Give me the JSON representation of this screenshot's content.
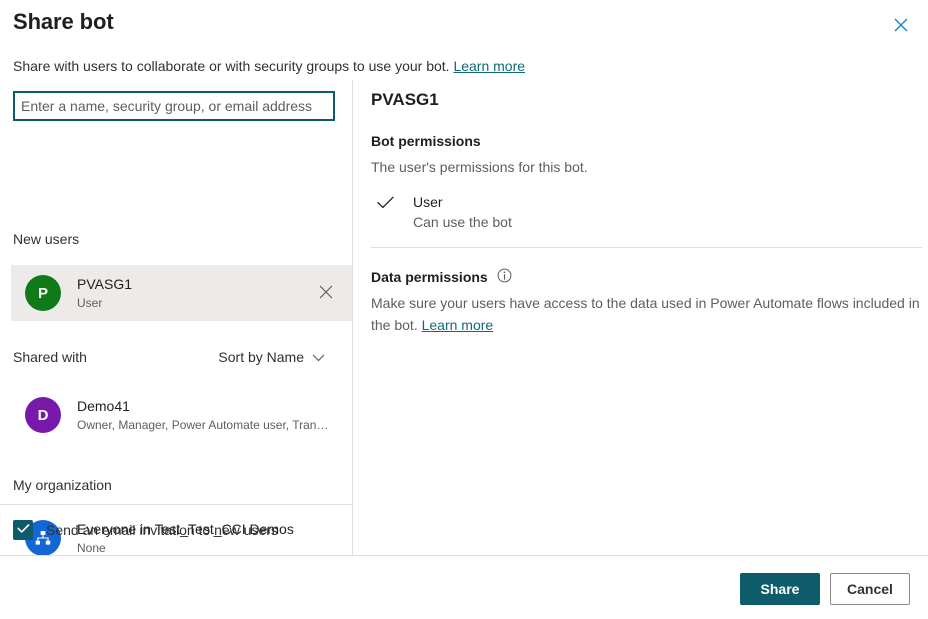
{
  "dialog": {
    "title": "Share bot",
    "subtitle_text": "Share with users to collaborate or with security groups to use your bot.",
    "subtitle_link": "Learn more",
    "close_icon": "close-icon"
  },
  "picker": {
    "value": "",
    "placeholder": "Enter a name, security group, or email address"
  },
  "left": {
    "new_users_label": "New users",
    "new_users": [
      {
        "name": "PVASG1",
        "sub": "User",
        "initial": "P",
        "avatar_color": "#117a18",
        "remove_icon": "close-icon",
        "selected": true
      }
    ],
    "shared_with_label": "Shared with",
    "sort_label": "Sort by Name",
    "sort_icon": "chevron-down-icon",
    "shared_with": [
      {
        "name": "Demo41",
        "sub": "Owner, Manager, Power Automate user, Transc...",
        "initial": "D",
        "avatar_color": "#7719aa"
      }
    ],
    "my_org_label": "My organization",
    "my_org": [
      {
        "name": "Everyone in Test_Test_CCI Demos",
        "sub": "None",
        "icon": "org-hierarchy-icon",
        "avatar_color": "#1266d6"
      }
    ],
    "email_invite": {
      "label": "Send an email invitation to new users",
      "checked": true
    }
  },
  "right": {
    "detail_title": "PVASG1",
    "bot_permissions_heading": "Bot permissions",
    "bot_permissions_desc": "The user's permissions for this bot.",
    "permission_option": {
      "name": "User",
      "sub": "Can use the bot",
      "selected": true,
      "check_icon": "checkmark-icon"
    },
    "data_permissions_heading": "Data permissions",
    "data_permissions_info_icon": "info-icon",
    "data_permissions_desc": "Make sure your users have access to the data used in Power Automate flows included in the bot.",
    "data_permissions_link": "Learn more"
  },
  "footer": {
    "primary_label": "Share",
    "secondary_label": "Cancel"
  },
  "colors": {
    "accent": "#0e5c6b",
    "link": "#106a78",
    "close": "#1787c8",
    "divider": "#e1dfdd",
    "selected_row": "#edebe9"
  }
}
